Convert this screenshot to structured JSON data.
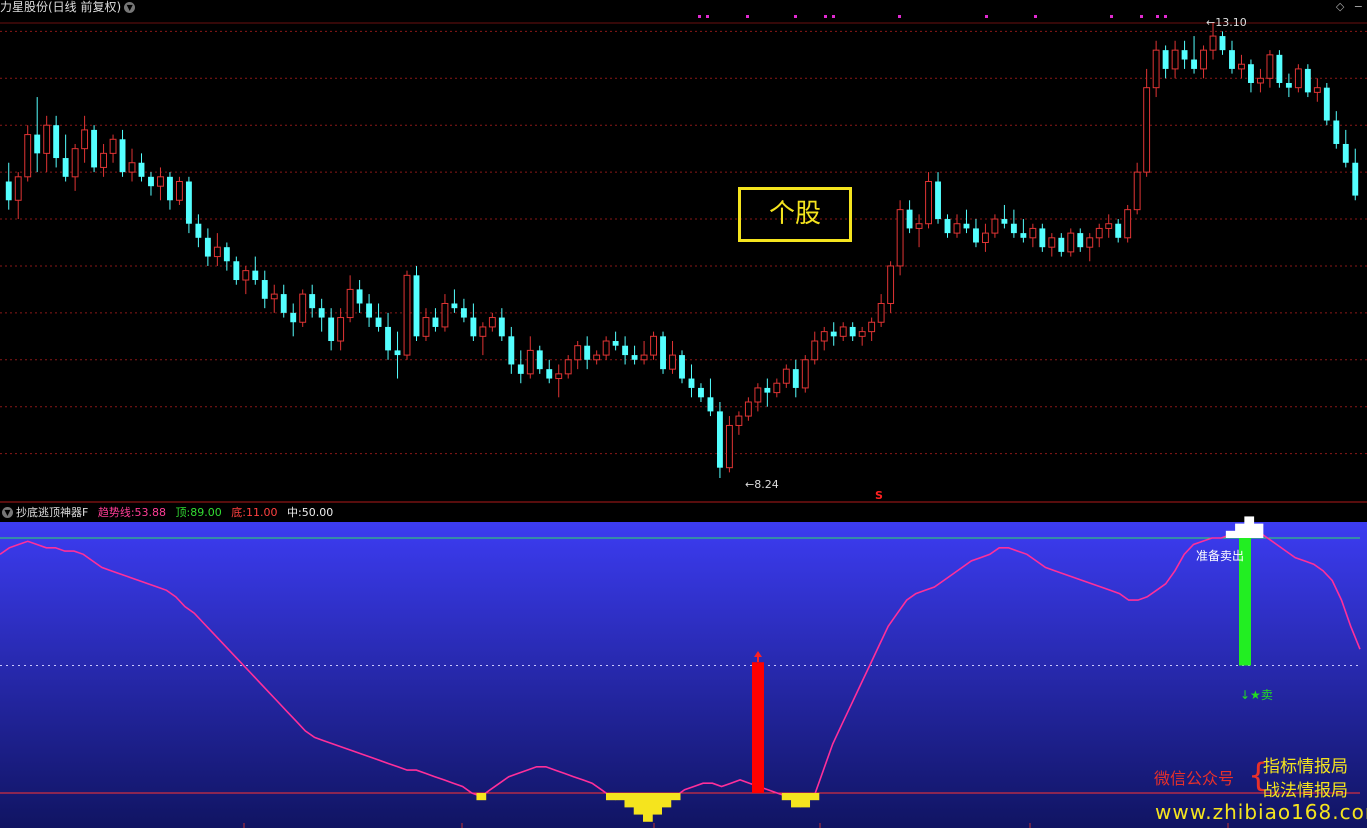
{
  "window_title": "力星股份(日线 前复权)",
  "top_controls": {
    "diamond": "◇",
    "minus": "−"
  },
  "stock_label": "个股",
  "price_high_label": "13.10",
  "price_low_label": "8.24",
  "s_marker": "S",
  "indicator": {
    "name": "抄底逃顶神器F",
    "trend_key": "趋势线:",
    "trend_value": "53.88",
    "top_key": "顶:",
    "top_value": "89.00",
    "bottom_key": "底:",
    "bottom_value": "11.00",
    "mid_key": "中:",
    "mid_value": "50.00"
  },
  "signals": {
    "ready_sell": "准备卖出",
    "sell_marker": "卖"
  },
  "watermark": {
    "wechat": "微信公众号",
    "brand_line1": "指标情报局",
    "brand_line2": "战法情报局",
    "url": "www.zhibiao168.com"
  },
  "colors": {
    "up": "#e03434",
    "down": "#54ffff",
    "trend_line": "#ff2f9a",
    "top_line": "#33dd66",
    "bottom_line": "#ff3333",
    "accent_yellow": "#f5e41e"
  },
  "chart_data": [
    {
      "type": "candlestick",
      "title": "力星股份(日线 前复权)",
      "price_high": 13.1,
      "price_low": 8.24,
      "candles": [
        [
          11.4,
          11.6,
          11.1,
          11.2
        ],
        [
          11.2,
          11.5,
          11.0,
          11.45
        ],
        [
          11.45,
          12.0,
          11.4,
          11.9
        ],
        [
          11.9,
          12.3,
          11.5,
          11.7
        ],
        [
          11.7,
          12.1,
          11.5,
          12.0
        ],
        [
          12.0,
          12.1,
          11.55,
          11.65
        ],
        [
          11.65,
          11.9,
          11.4,
          11.45
        ],
        [
          11.45,
          11.8,
          11.3,
          11.75
        ],
        [
          11.75,
          12.1,
          11.6,
          11.95
        ],
        [
          11.95,
          12.0,
          11.5,
          11.55
        ],
        [
          11.55,
          11.8,
          11.45,
          11.7
        ],
        [
          11.7,
          11.9,
          11.6,
          11.85
        ],
        [
          11.85,
          11.95,
          11.45,
          11.5
        ],
        [
          11.5,
          11.75,
          11.4,
          11.6
        ],
        [
          11.6,
          11.7,
          11.4,
          11.45
        ],
        [
          11.45,
          11.5,
          11.25,
          11.35
        ],
        [
          11.35,
          11.55,
          11.2,
          11.45
        ],
        [
          11.45,
          11.5,
          11.1,
          11.2
        ],
        [
          11.2,
          11.45,
          11.15,
          11.4
        ],
        [
          11.4,
          11.45,
          10.85,
          10.95
        ],
        [
          10.95,
          11.05,
          10.7,
          10.8
        ],
        [
          10.8,
          10.9,
          10.5,
          10.6
        ],
        [
          10.6,
          10.85,
          10.5,
          10.7
        ],
        [
          10.7,
          10.75,
          10.45,
          10.55
        ],
        [
          10.55,
          10.6,
          10.3,
          10.35
        ],
        [
          10.35,
          10.5,
          10.2,
          10.45
        ],
        [
          10.45,
          10.6,
          10.3,
          10.35
        ],
        [
          10.35,
          10.45,
          10.05,
          10.15
        ],
        [
          10.15,
          10.3,
          10.0,
          10.2
        ],
        [
          10.2,
          10.3,
          9.95,
          10.0
        ],
        [
          10.0,
          10.1,
          9.75,
          9.9
        ],
        [
          9.9,
          10.25,
          9.85,
          10.2
        ],
        [
          10.2,
          10.3,
          9.95,
          10.05
        ],
        [
          10.05,
          10.15,
          9.8,
          9.95
        ],
        [
          9.95,
          10.05,
          9.6,
          9.7
        ],
        [
          9.7,
          10.05,
          9.6,
          9.95
        ],
        [
          9.95,
          10.4,
          9.9,
          10.25
        ],
        [
          10.25,
          10.35,
          10.0,
          10.1
        ],
        [
          10.1,
          10.2,
          9.85,
          9.95
        ],
        [
          9.95,
          10.1,
          9.8,
          9.85
        ],
        [
          9.85,
          10.0,
          9.5,
          9.6
        ],
        [
          9.6,
          9.8,
          9.3,
          9.55
        ],
        [
          9.55,
          10.45,
          9.5,
          10.4
        ],
        [
          10.4,
          10.5,
          9.7,
          9.75
        ],
        [
          9.75,
          10.05,
          9.7,
          9.95
        ],
        [
          9.95,
          10.05,
          9.8,
          9.85
        ],
        [
          9.85,
          10.2,
          9.8,
          10.1
        ],
        [
          10.1,
          10.25,
          10.0,
          10.05
        ],
        [
          10.05,
          10.15,
          9.9,
          9.95
        ],
        [
          9.95,
          10.1,
          9.7,
          9.75
        ],
        [
          9.75,
          9.9,
          9.55,
          9.85
        ],
        [
          9.85,
          10.0,
          9.8,
          9.95
        ],
        [
          9.95,
          10.05,
          9.7,
          9.75
        ],
        [
          9.75,
          9.85,
          9.35,
          9.45
        ],
        [
          9.45,
          9.6,
          9.25,
          9.35
        ],
        [
          9.35,
          9.75,
          9.3,
          9.6
        ],
        [
          9.6,
          9.65,
          9.35,
          9.4
        ],
        [
          9.4,
          9.5,
          9.25,
          9.3
        ],
        [
          9.3,
          9.45,
          9.1,
          9.35
        ],
        [
          9.35,
          9.55,
          9.3,
          9.5
        ],
        [
          9.5,
          9.7,
          9.4,
          9.65
        ],
        [
          9.65,
          9.75,
          9.4,
          9.5
        ],
        [
          9.5,
          9.6,
          9.45,
          9.55
        ],
        [
          9.55,
          9.75,
          9.5,
          9.7
        ],
        [
          9.7,
          9.8,
          9.6,
          9.65
        ],
        [
          9.65,
          9.75,
          9.45,
          9.55
        ],
        [
          9.55,
          9.65,
          9.45,
          9.5
        ],
        [
          9.5,
          9.7,
          9.45,
          9.55
        ],
        [
          9.55,
          9.8,
          9.5,
          9.75
        ],
        [
          9.75,
          9.8,
          9.35,
          9.4
        ],
        [
          9.4,
          9.7,
          9.35,
          9.55
        ],
        [
          9.55,
          9.6,
          9.25,
          9.3
        ],
        [
          9.3,
          9.45,
          9.1,
          9.2
        ],
        [
          9.2,
          9.25,
          9.05,
          9.1
        ],
        [
          9.1,
          9.3,
          8.9,
          8.95
        ],
        [
          8.95,
          9.05,
          8.24,
          8.35
        ],
        [
          8.35,
          8.9,
          8.3,
          8.8
        ],
        [
          8.8,
          8.95,
          8.7,
          8.9
        ],
        [
          8.9,
          9.1,
          8.85,
          9.05
        ],
        [
          9.05,
          9.25,
          8.95,
          9.2
        ],
        [
          9.2,
          9.3,
          9.0,
          9.15
        ],
        [
          9.15,
          9.3,
          9.1,
          9.25
        ],
        [
          9.25,
          9.45,
          9.2,
          9.4
        ],
        [
          9.4,
          9.5,
          9.1,
          9.2
        ],
        [
          9.2,
          9.55,
          9.15,
          9.5
        ],
        [
          9.5,
          9.8,
          9.45,
          9.7
        ],
        [
          9.7,
          9.85,
          9.6,
          9.8
        ],
        [
          9.8,
          9.9,
          9.65,
          9.75
        ],
        [
          9.75,
          9.9,
          9.7,
          9.85
        ],
        [
          9.85,
          9.9,
          9.7,
          9.75
        ],
        [
          9.75,
          9.85,
          9.65,
          9.8
        ],
        [
          9.8,
          9.95,
          9.7,
          9.9
        ],
        [
          9.9,
          10.2,
          9.85,
          10.1
        ],
        [
          10.1,
          10.55,
          10.0,
          10.5
        ],
        [
          10.5,
          11.2,
          10.4,
          11.1
        ],
        [
          11.1,
          11.2,
          10.85,
          10.9
        ],
        [
          10.9,
          11.05,
          10.7,
          10.95
        ],
        [
          10.95,
          11.5,
          10.9,
          11.4
        ],
        [
          11.4,
          11.5,
          10.95,
          11.0
        ],
        [
          11.0,
          11.05,
          10.8,
          10.85
        ],
        [
          10.85,
          11.05,
          10.8,
          10.95
        ],
        [
          10.95,
          11.1,
          10.85,
          10.9
        ],
        [
          10.9,
          11.0,
          10.7,
          10.75
        ],
        [
          10.75,
          10.95,
          10.65,
          10.85
        ],
        [
          10.85,
          11.05,
          10.8,
          11.0
        ],
        [
          11.0,
          11.15,
          10.9,
          10.95
        ],
        [
          10.95,
          11.1,
          10.8,
          10.85
        ],
        [
          10.85,
          11.0,
          10.75,
          10.8
        ],
        [
          10.8,
          10.95,
          10.7,
          10.9
        ],
        [
          10.9,
          10.95,
          10.65,
          10.7
        ],
        [
          10.7,
          10.85,
          10.6,
          10.8
        ],
        [
          10.8,
          10.85,
          10.6,
          10.65
        ],
        [
          10.65,
          10.9,
          10.6,
          10.85
        ],
        [
          10.85,
          10.9,
          10.65,
          10.7
        ],
        [
          10.7,
          10.85,
          10.55,
          10.8
        ],
        [
          10.8,
          10.95,
          10.7,
          10.9
        ],
        [
          10.9,
          11.05,
          10.8,
          10.95
        ],
        [
          10.95,
          11.0,
          10.75,
          10.8
        ],
        [
          10.8,
          11.15,
          10.75,
          11.1
        ],
        [
          11.1,
          11.6,
          11.05,
          11.5
        ],
        [
          11.5,
          12.6,
          11.45,
          12.4
        ],
        [
          12.4,
          12.9,
          12.3,
          12.8
        ],
        [
          12.8,
          12.85,
          12.5,
          12.6
        ],
        [
          12.6,
          12.9,
          12.5,
          12.8
        ],
        [
          12.8,
          12.9,
          12.6,
          12.7
        ],
        [
          12.7,
          12.95,
          12.55,
          12.6
        ],
        [
          12.6,
          12.85,
          12.5,
          12.8
        ],
        [
          12.8,
          13.1,
          12.7,
          12.95
        ],
        [
          12.95,
          13.0,
          12.75,
          12.8
        ],
        [
          12.8,
          12.9,
          12.55,
          12.6
        ],
        [
          12.6,
          12.75,
          12.5,
          12.65
        ],
        [
          12.65,
          12.7,
          12.35,
          12.45
        ],
        [
          12.45,
          12.6,
          12.35,
          12.5
        ],
        [
          12.5,
          12.8,
          12.4,
          12.75
        ],
        [
          12.75,
          12.8,
          12.4,
          12.45
        ],
        [
          12.45,
          12.55,
          12.3,
          12.4
        ],
        [
          12.4,
          12.65,
          12.35,
          12.6
        ],
        [
          12.6,
          12.65,
          12.3,
          12.35
        ],
        [
          12.35,
          12.5,
          12.25,
          12.4
        ],
        [
          12.4,
          12.45,
          12.0,
          12.05
        ],
        [
          12.05,
          12.15,
          11.75,
          11.8
        ],
        [
          11.8,
          11.95,
          11.55,
          11.6
        ],
        [
          11.6,
          11.75,
          11.2,
          11.25
        ]
      ]
    },
    {
      "type": "line",
      "title": "抄底逃顶神器F",
      "ylim": [
        0,
        100
      ],
      "levels": {
        "top": 89.0,
        "mid": 50.0,
        "bottom": 11.0
      },
      "trend": [
        84,
        86,
        87,
        88,
        87,
        86,
        86,
        85,
        85,
        84,
        82,
        80,
        79,
        78,
        77,
        76,
        75,
        74,
        73,
        71,
        68,
        66,
        63,
        60,
        57,
        54,
        51,
        48,
        45,
        42,
        39,
        36,
        33,
        30,
        28,
        27,
        26,
        25,
        24,
        23,
        22,
        21,
        20,
        19,
        18,
        18,
        17,
        16,
        15,
        14,
        13,
        11,
        10,
        12,
        14,
        16,
        17,
        18,
        19,
        19,
        18,
        17,
        16,
        15,
        14,
        12,
        10,
        10,
        9,
        8,
        7,
        8,
        9,
        10,
        12,
        13,
        14,
        14,
        13,
        14,
        15,
        14,
        13,
        12,
        11,
        10,
        9,
        9,
        10,
        18,
        26,
        32,
        38,
        44,
        50,
        56,
        62,
        66,
        70,
        72,
        73,
        74,
        76,
        78,
        80,
        82,
        83,
        84,
        86,
        86,
        85,
        84,
        82,
        80,
        79,
        78,
        77,
        76,
        75,
        74,
        73,
        72,
        70,
        70,
        71,
        73,
        75,
        79,
        84,
        87,
        88,
        89,
        89,
        90,
        91,
        92,
        91,
        89,
        87,
        85,
        83,
        82,
        81,
        79,
        76,
        70,
        62,
        55
      ],
      "signal_bars": [
        {
          "kind": "buy",
          "value": 51
        },
        {
          "kind": "sell",
          "value": 50
        }
      ]
    }
  ]
}
